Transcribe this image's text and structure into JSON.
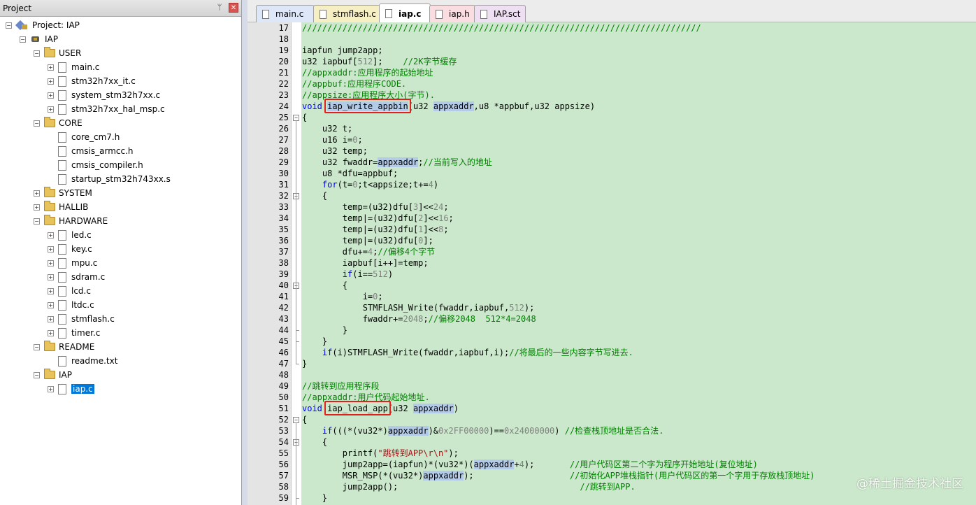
{
  "project_pane": {
    "title": "Project",
    "pin_glyph": "ᛘ",
    "close_glyph": "✕",
    "tree": [
      {
        "label": "Project: IAP",
        "icon": "project-icon",
        "expander": "−",
        "depth": 0
      },
      {
        "label": "IAP",
        "icon": "target-icon",
        "expander": "−",
        "depth": 1
      },
      {
        "label": "USER",
        "icon": "folder-icon",
        "expander": "−",
        "depth": 2
      },
      {
        "label": "main.c",
        "icon": "file-icon",
        "expander": "+",
        "depth": 3
      },
      {
        "label": "stm32h7xx_it.c",
        "icon": "file-icon",
        "expander": "+",
        "depth": 3
      },
      {
        "label": "system_stm32h7xx.c",
        "icon": "file-icon",
        "expander": "+",
        "depth": 3
      },
      {
        "label": "stm32h7xx_hal_msp.c",
        "icon": "file-icon",
        "expander": "+",
        "depth": 3
      },
      {
        "label": "CORE",
        "icon": "folder-icon",
        "expander": "−",
        "depth": 2
      },
      {
        "label": "core_cm7.h",
        "icon": "file-icon",
        "expander": "",
        "depth": 3
      },
      {
        "label": "cmsis_armcc.h",
        "icon": "file-icon",
        "expander": "",
        "depth": 3
      },
      {
        "label": "cmsis_compiler.h",
        "icon": "file-icon",
        "expander": "",
        "depth": 3
      },
      {
        "label": "startup_stm32h743xx.s",
        "icon": "file-icon",
        "expander": "",
        "depth": 3
      },
      {
        "label": "SYSTEM",
        "icon": "folder-icon",
        "expander": "+",
        "depth": 2
      },
      {
        "label": "HALLIB",
        "icon": "folder-icon",
        "expander": "+",
        "depth": 2
      },
      {
        "label": "HARDWARE",
        "icon": "folder-icon",
        "expander": "−",
        "depth": 2
      },
      {
        "label": "led.c",
        "icon": "file-icon",
        "expander": "+",
        "depth": 3
      },
      {
        "label": "key.c",
        "icon": "file-icon",
        "expander": "+",
        "depth": 3
      },
      {
        "label": "mpu.c",
        "icon": "file-icon",
        "expander": "+",
        "depth": 3
      },
      {
        "label": "sdram.c",
        "icon": "file-icon",
        "expander": "+",
        "depth": 3
      },
      {
        "label": "lcd.c",
        "icon": "file-icon",
        "expander": "+",
        "depth": 3
      },
      {
        "label": "ltdc.c",
        "icon": "file-icon",
        "expander": "+",
        "depth": 3
      },
      {
        "label": "stmflash.c",
        "icon": "file-icon",
        "expander": "+",
        "depth": 3
      },
      {
        "label": "timer.c",
        "icon": "file-icon",
        "expander": "+",
        "depth": 3
      },
      {
        "label": "README",
        "icon": "folder-icon",
        "expander": "−",
        "depth": 2
      },
      {
        "label": "readme.txt",
        "icon": "file-icon",
        "expander": "",
        "depth": 3
      },
      {
        "label": "IAP",
        "icon": "folder-icon",
        "expander": "−",
        "depth": 2
      },
      {
        "label": "iap.c",
        "icon": "file-icon",
        "expander": "+",
        "depth": 3,
        "selected": true
      }
    ]
  },
  "tabs": [
    {
      "label": "main.c",
      "color": "#dde7f7",
      "active": false
    },
    {
      "label": "stmflash.c",
      "color": "#f7efc4",
      "active": false
    },
    {
      "label": "iap.c",
      "color": "#ffffff",
      "active": true
    },
    {
      "label": "iap.h",
      "color": "#f9dde0",
      "active": false
    },
    {
      "label": "IAP.sct",
      "color": "#eedff2",
      "active": false
    }
  ],
  "editor": {
    "lines": [
      {
        "n": "17",
        "fold": "",
        "html": "<span class=\"cm\">///////////////////////////////////////////////////////////////////////////////</span>"
      },
      {
        "n": "18",
        "fold": "",
        "html": ""
      },
      {
        "n": "19",
        "fold": "",
        "html": "iapfun jump2app;"
      },
      {
        "n": "20",
        "fold": "",
        "html": "u32 iapbuf[<span class=\"num\">512</span>];    <span class=\"cm\">//2K字节缓存</span>"
      },
      {
        "n": "21",
        "fold": "",
        "html": "<span class=\"cm\">//appxaddr:应用程序的起始地址</span>"
      },
      {
        "n": "22",
        "fold": "",
        "html": "<span class=\"cm\">//appbuf:应用程序CODE.</span>"
      },
      {
        "n": "23",
        "fold": "",
        "html": "<span class=\"cm\">//appsize:应用程序大小(字节).</span>"
      },
      {
        "n": "24",
        "fold": "",
        "html": "<span class=\"kw\">void</span> <span class=\"hl\">iap_write_appbin</span>(u32 <span class=\"hl\">appxaddr</span>,u8 *appbuf,u32 appsize)"
      },
      {
        "n": "25",
        "fold": "start",
        "html": "{"
      },
      {
        "n": "26",
        "fold": "",
        "html": "    u32 t;"
      },
      {
        "n": "27",
        "fold": "",
        "html": "    u16 i=<span class=\"num\">0</span>;"
      },
      {
        "n": "28",
        "fold": "",
        "html": "    u32 temp;"
      },
      {
        "n": "29",
        "fold": "",
        "html": "    u32 fwaddr=<span class=\"hl\">appxaddr</span>;<span class=\"cm\">//当前写入的地址</span>"
      },
      {
        "n": "30",
        "fold": "",
        "html": "    u8 *dfu=appbuf;"
      },
      {
        "n": "31",
        "fold": "",
        "html": "    <span class=\"kw\">for</span>(t=<span class=\"num\">0</span>;t&lt;appsize;t+=<span class=\"num\">4</span>)"
      },
      {
        "n": "32",
        "fold": "start",
        "html": "    {"
      },
      {
        "n": "33",
        "fold": "",
        "html": "        temp=(u32)dfu[<span class=\"num\">3</span>]&lt;&lt;<span class=\"num\">24</span>;"
      },
      {
        "n": "34",
        "fold": "",
        "html": "        temp|=(u32)dfu[<span class=\"num\">2</span>]&lt;&lt;<span class=\"num\">16</span>;"
      },
      {
        "n": "35",
        "fold": "",
        "html": "        temp|=(u32)dfu[<span class=\"num\">1</span>]&lt;&lt;<span class=\"num\">8</span>;"
      },
      {
        "n": "36",
        "fold": "",
        "html": "        temp|=(u32)dfu[<span class=\"num\">0</span>];"
      },
      {
        "n": "37",
        "fold": "",
        "html": "        dfu+=<span class=\"num\">4</span>;<span class=\"cm\">//偏移4个字节</span>"
      },
      {
        "n": "38",
        "fold": "",
        "html": "        iapbuf[i++]=temp;"
      },
      {
        "n": "39",
        "fold": "",
        "html": "        <span class=\"kw\">if</span>(i==<span class=\"num\">512</span>)"
      },
      {
        "n": "40",
        "fold": "start",
        "html": "        {"
      },
      {
        "n": "41",
        "fold": "",
        "html": "            i=<span class=\"num\">0</span>;"
      },
      {
        "n": "42",
        "fold": "",
        "html": "            STMFLASH_Write(fwaddr,iapbuf,<span class=\"num\">512</span>);"
      },
      {
        "n": "43",
        "fold": "",
        "html": "            fwaddr+=<span class=\"num\">2048</span>;<span class=\"cm\">//偏移2048  512*4=2048</span>"
      },
      {
        "n": "44",
        "fold": "end",
        "html": "        }"
      },
      {
        "n": "45",
        "fold": "end",
        "html": "    }"
      },
      {
        "n": "46",
        "fold": "",
        "html": "    <span class=\"kw\">if</span>(i)STMFLASH_Write(fwaddr,iapbuf,i);<span class=\"cm\">//将最后的一些内容字节写进去.</span>"
      },
      {
        "n": "47",
        "fold": "end",
        "html": "}"
      },
      {
        "n": "48",
        "fold": "",
        "html": ""
      },
      {
        "n": "49",
        "fold": "",
        "html": "<span class=\"cm\">//跳转到应用程序段</span>"
      },
      {
        "n": "50",
        "fold": "",
        "html": "<span class=\"cm\">//appxaddr:用户代码起始地址.</span>"
      },
      {
        "n": "51",
        "fold": "",
        "html": "<span class=\"kw\">void</span> iap_load_app(u32 <span class=\"hl\">appxaddr</span>)"
      },
      {
        "n": "52",
        "fold": "start",
        "html": "{"
      },
      {
        "n": "53",
        "fold": "",
        "html": "    <span class=\"kw\">if</span>(((*(vu32*)<span class=\"hl\">appxaddr</span>)&amp;<span class=\"num\">0x2FF00000</span>)==<span class=\"num\">0x24000000</span>) <span class=\"cm\">//检查栈顶地址是否合法.</span>"
      },
      {
        "n": "54",
        "fold": "start",
        "html": "    {"
      },
      {
        "n": "55",
        "fold": "",
        "html": "        printf(<span class=\"str\">\"跳转到APP\\r\\n\"</span>);"
      },
      {
        "n": "56",
        "fold": "",
        "html": "        jump2app=(iapfun)*(vu32*)(<span class=\"hl\">appxaddr</span>+<span class=\"num\">4</span>);       <span class=\"cm\">//用户代码区第二个字为程序开始地址(复位地址)</span>"
      },
      {
        "n": "57",
        "fold": "",
        "html": "        MSR_MSP(*(vu32*)<span class=\"hl\">appxaddr</span>);                   <span class=\"cm\">//初始化APP堆栈指针(用户代码区的第一个字用于存放栈顶地址)</span>"
      },
      {
        "n": "58",
        "fold": "",
        "html": "        jump2app();                                    <span class=\"cm\">//跳转到APP.</span>"
      },
      {
        "n": "59",
        "fold": "end",
        "html": "    }"
      }
    ],
    "annotations": [
      {
        "label": "iap_write_appbin"
      },
      {
        "label": "iap_load_app"
      }
    ]
  },
  "watermark": "@稀土掘金技术社区"
}
